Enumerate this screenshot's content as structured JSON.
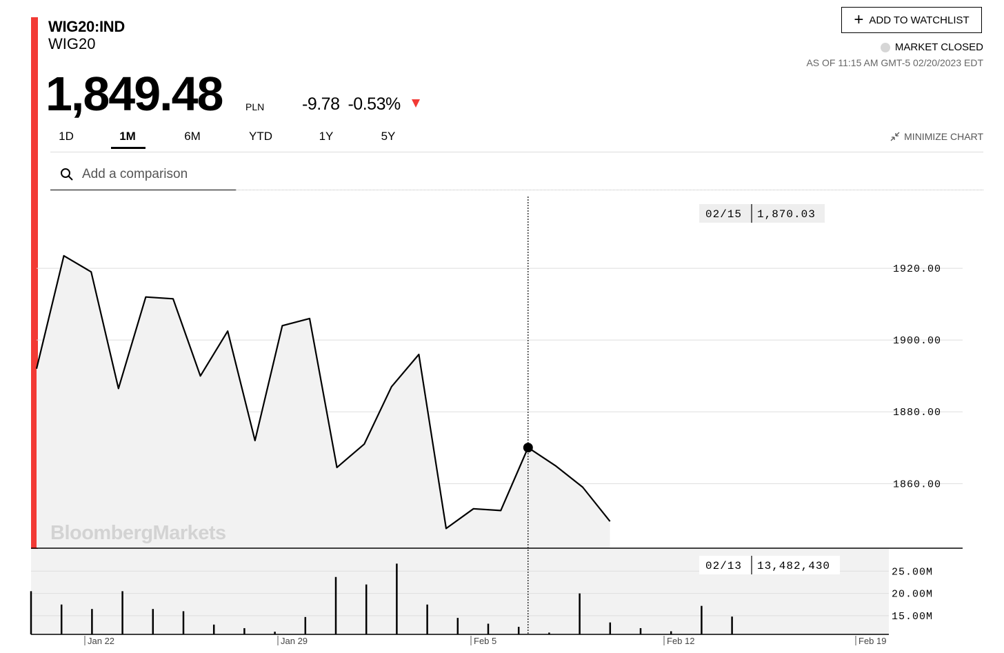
{
  "header": {
    "ticker": "WIG20:IND",
    "name": "WIG20",
    "price": "1,849.48",
    "currency": "PLN",
    "change": "-9.78",
    "change_pct": "-0.53%",
    "watchlist_label": "ADD TO WATCHLIST",
    "market_status": "MARKET CLOSED",
    "as_of": "AS OF 11:15 AM GMT-5 02/20/2023 EDT"
  },
  "tabs": [
    "1D",
    "1M",
    "6M",
    "YTD",
    "1Y",
    "5Y"
  ],
  "active_tab": "1M",
  "minimize_label": "MINIMIZE CHART",
  "search": {
    "placeholder": "Add a comparison"
  },
  "watermark": "BloombergMarkets",
  "colors": {
    "accent": "#f23a35",
    "line": "#000000",
    "area": "#f2f2f2"
  },
  "chart_data": [
    {
      "type": "line",
      "x": [
        "01/20",
        "01/23",
        "01/24",
        "01/25",
        "01/26",
        "01/27",
        "01/30",
        "01/31",
        "02/01",
        "02/02",
        "02/03",
        "02/06",
        "02/07",
        "02/08",
        "02/09",
        "02/10",
        "02/13",
        "02/14",
        "02/15",
        "02/16",
        "02/17",
        "02/20"
      ],
      "values": [
        1892,
        1923.5,
        1919,
        1886.5,
        1912,
        1911.5,
        1890,
        1902.5,
        1872,
        1904,
        1906,
        1864.5,
        1871,
        1887,
        1896,
        1847.5,
        1853,
        1852.5,
        1870.03,
        1865,
        1859,
        1849.48
      ],
      "ylim": [
        1842,
        1940
      ],
      "yticks": [
        "1920.00",
        "1900.00",
        "1880.00",
        "1860.00"
      ],
      "x_tick_labels": [
        "Jan 22",
        "Jan 29",
        "Feb 5",
        "Feb 12",
        "Feb 19"
      ],
      "tooltip": {
        "date": "02/15",
        "value": "1,870.03"
      }
    },
    {
      "type": "bar",
      "values_m": [
        20.5,
        17.5,
        16.5,
        20.5,
        16.5,
        16,
        13,
        12.2,
        11.4,
        14.7,
        23.7,
        22,
        26.7,
        17.5,
        14.5,
        13.2,
        12.5,
        11.2,
        20,
        13.48,
        12.2,
        11.5,
        17.2,
        14.8
      ],
      "ylim_m": [
        10.8,
        30
      ],
      "yticks": [
        "25.00M",
        "20.00M",
        "15.00M"
      ],
      "tooltip": {
        "date": "02/13",
        "value": "13,482,430"
      }
    }
  ]
}
